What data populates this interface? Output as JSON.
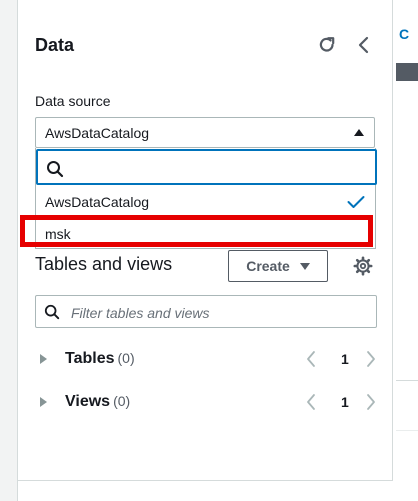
{
  "panel": {
    "title": "Data",
    "data_source_label": "Data source",
    "selected_source": "AwsDataCatalog",
    "dropdown": {
      "options": [
        "AwsDataCatalog",
        "msk"
      ],
      "selected_index": 0
    },
    "tables_views": {
      "title": "Tables and views",
      "create_label": "Create",
      "search_placeholder": "Filter tables and views",
      "tables_label": "Tables",
      "tables_count": "(0)",
      "tables_page": "1",
      "views_label": "Views",
      "views_count": "(0)",
      "views_page": "1"
    }
  },
  "right_pane": {
    "tab_glyph": "C"
  },
  "colors": {
    "accent": "#0073bb",
    "highlight": "#e60000",
    "text": "#16191f",
    "muted": "#687078"
  }
}
